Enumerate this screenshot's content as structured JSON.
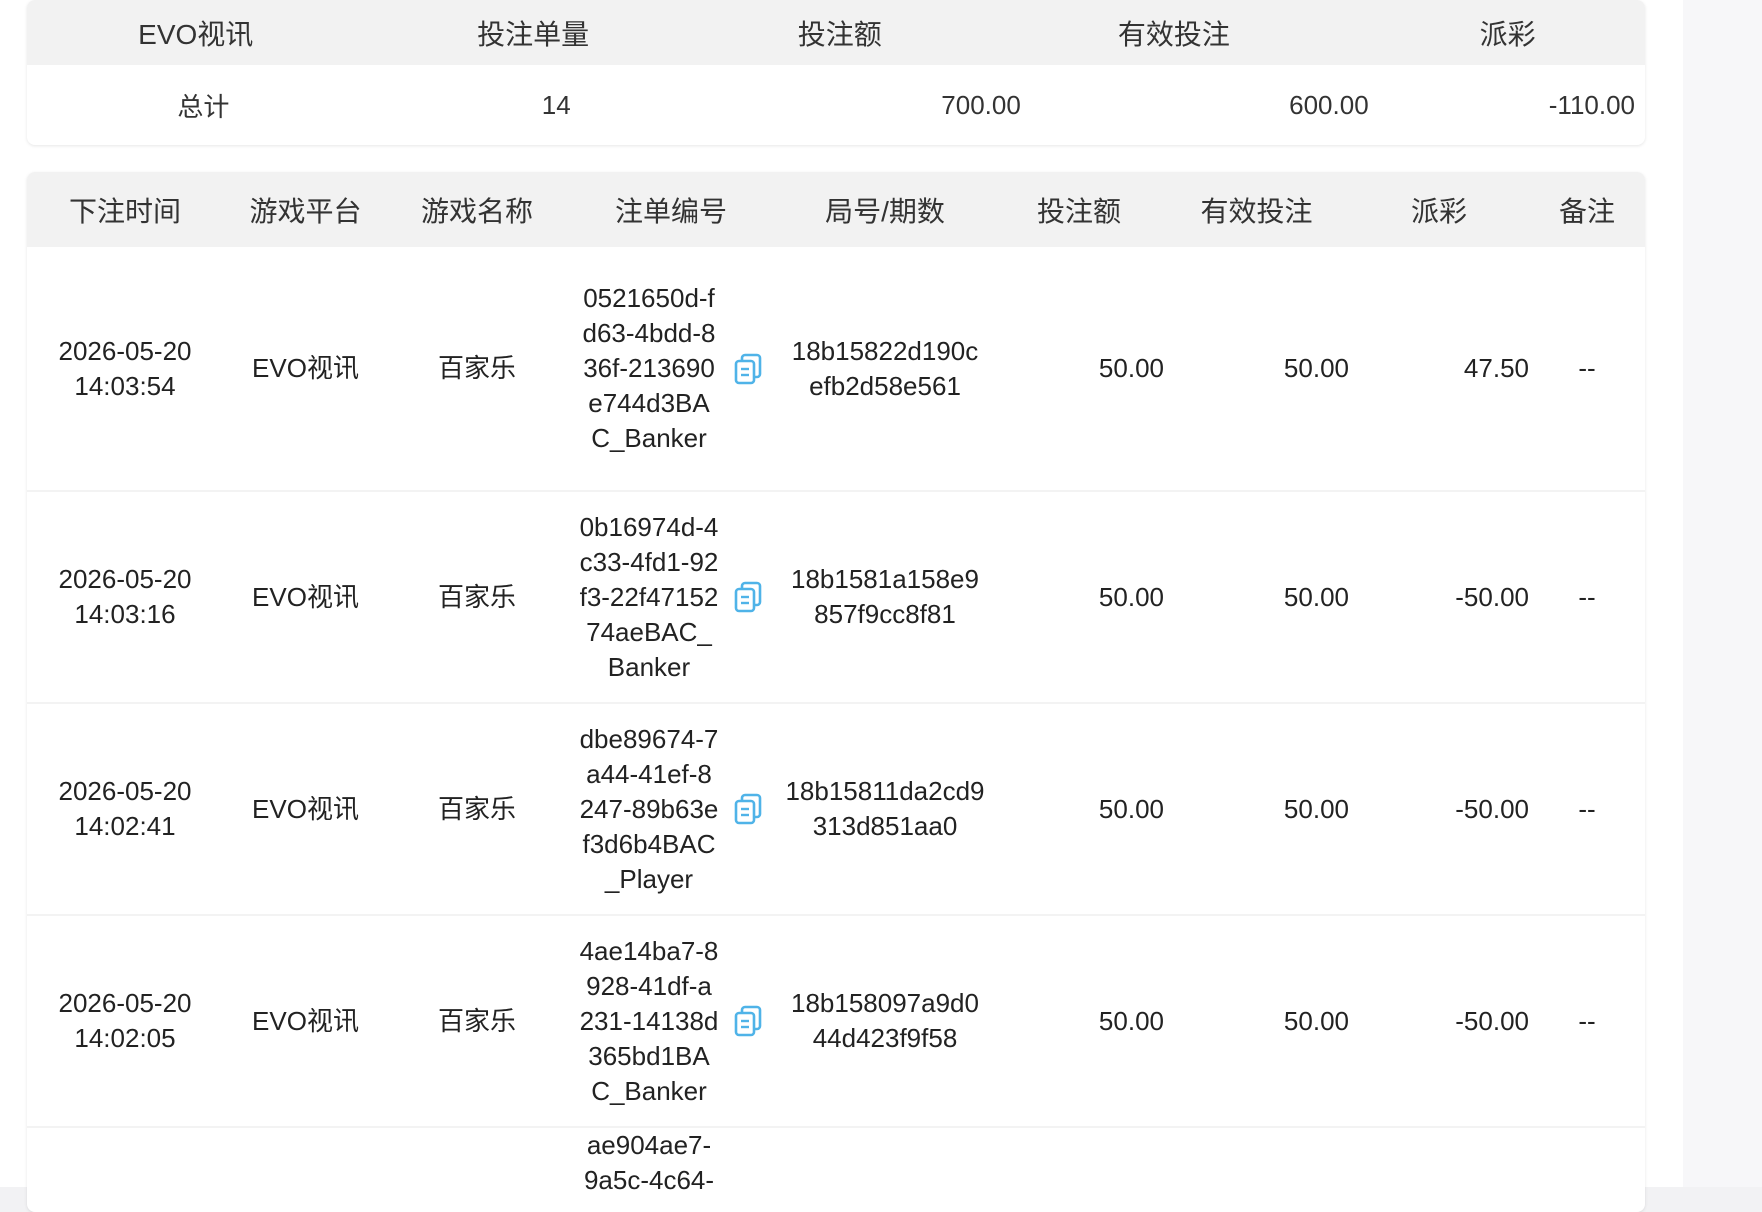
{
  "summary": {
    "headers": [
      "EVO视讯",
      "投注单量",
      "投注额",
      "有效投注",
      "派彩"
    ],
    "row": {
      "label": "总计",
      "count": "14",
      "bet": "700.00",
      "valid": "600.00",
      "payout": "-110.00"
    }
  },
  "table": {
    "headers": [
      "下注时间",
      "游戏平台",
      "游戏名称",
      "注单编号",
      "局号/期数",
      "投注额",
      "有效投注",
      "派彩",
      "备注"
    ],
    "rows": [
      {
        "date": "2026-05-20",
        "time": "14:03:54",
        "platform": "EVO视讯",
        "game": "百家乐",
        "order": "0521650d-fd63-4bdd-836f-213690e744d3BAC_Banker",
        "round": "18b15822d190cefb2d58e561",
        "bet": "50.00",
        "valid": "50.00",
        "payout": "47.50",
        "note": "--"
      },
      {
        "date": "2026-05-20",
        "time": "14:03:16",
        "platform": "EVO视讯",
        "game": "百家乐",
        "order": "0b16974d-4c33-4fd1-92f3-22f4715274aeBAC_Banker",
        "round": "18b1581a158e9857f9cc8f81",
        "bet": "50.00",
        "valid": "50.00",
        "payout": "-50.00",
        "note": "--"
      },
      {
        "date": "2026-05-20",
        "time": "14:02:41",
        "platform": "EVO视讯",
        "game": "百家乐",
        "order": "dbe89674-7a44-41ef-8247-89b63ef3d6b4BAC_Player",
        "round": "18b15811da2cd9313d851aa0",
        "bet": "50.00",
        "valid": "50.00",
        "payout": "-50.00",
        "note": "--"
      },
      {
        "date": "2026-05-20",
        "time": "14:02:05",
        "platform": "EVO视讯",
        "game": "百家乐",
        "order": "4ae14ba7-8928-41df-a231-14138d365bd1BAC_Banker",
        "round": "18b158097a9d044d423f9f58",
        "bet": "50.00",
        "valid": "50.00",
        "payout": "-50.00",
        "note": "--"
      },
      {
        "order_partial_line1": "ae904ae7-",
        "order_partial_line2": "9a5c-4c64-"
      }
    ]
  },
  "colors": {
    "negative": "#f0467f",
    "copy_icon": "#4fb3e8",
    "header_bg": "#f2f2f2"
  },
  "icons": {
    "copy": "copy-icon"
  }
}
